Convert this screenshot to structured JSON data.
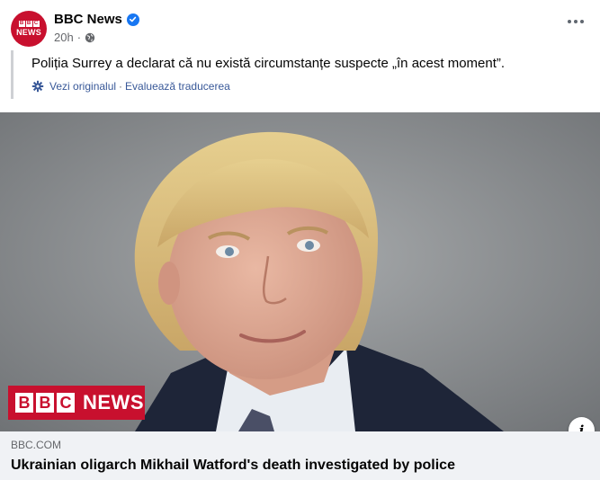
{
  "post": {
    "page_name": "BBC News",
    "avatar": {
      "blocks": [
        "B",
        "B",
        "C"
      ],
      "label": "NEWS"
    },
    "time": "20h",
    "privacy_icon": "globe-icon",
    "verified_icon": "verified-badge-icon",
    "more_icon": "more-options-icon"
  },
  "translation": {
    "text": "Poliția Surrey a declarat că nu există circumstanțe suspecte „în acest moment”.",
    "see_original": "Vezi originalul",
    "separator": "·",
    "rate_translation": "Evaluează traducerea",
    "icon": "translate-gear-icon"
  },
  "image": {
    "overlay_blocks": [
      "B",
      "B",
      "C"
    ],
    "overlay_news": "NEWS",
    "info_label": "i"
  },
  "link": {
    "domain": "BBC.COM",
    "headline": "Ukrainian oligarch Mikhail Watford's death investigated by police"
  },
  "colors": {
    "bbc_red": "#c8102e",
    "link_blue": "#385898",
    "secondary_text": "#65676b",
    "verified_blue": "#1877f2"
  }
}
